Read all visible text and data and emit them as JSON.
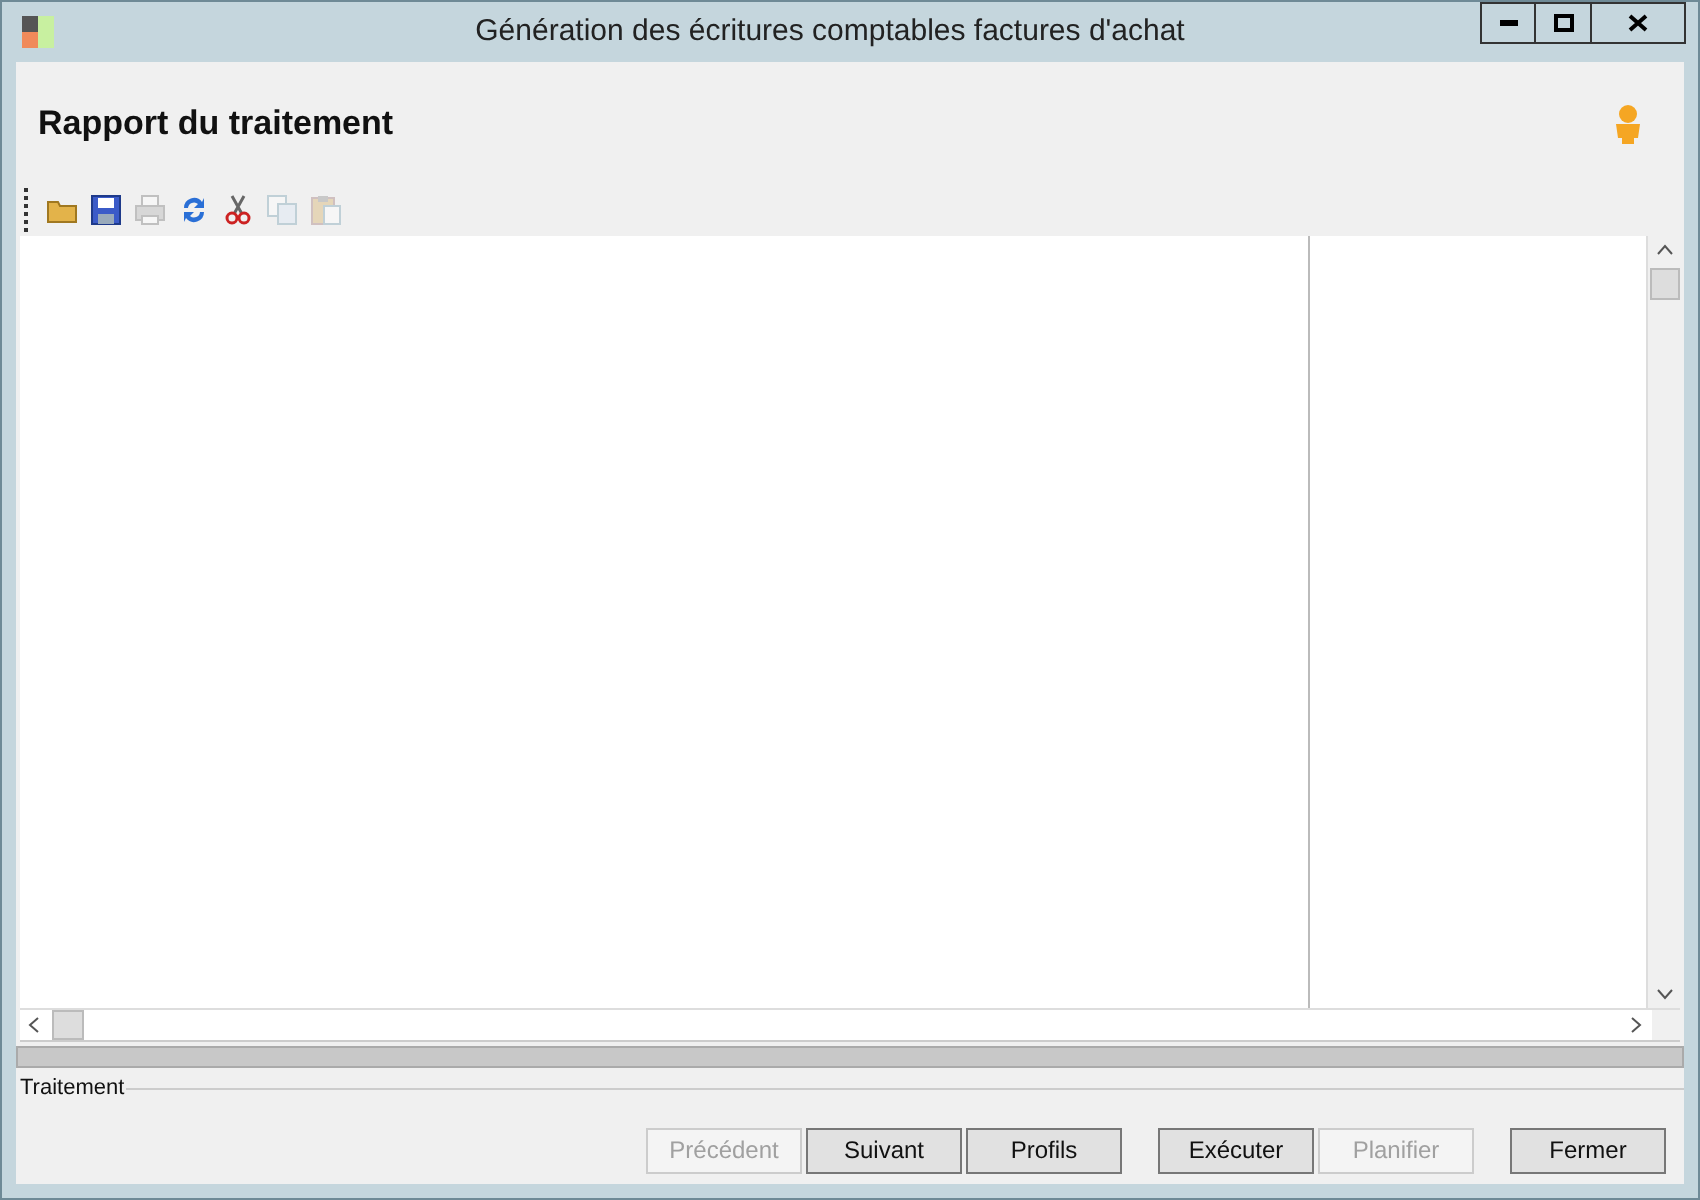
{
  "window": {
    "title": "Génération des écritures comptables factures d'achat"
  },
  "header": {
    "title": "Rapport du traitement"
  },
  "toolbar": [
    {
      "kind": "folder",
      "disabled": false
    },
    {
      "kind": "save",
      "disabled": false
    },
    {
      "kind": "print",
      "disabled": true
    },
    {
      "kind": "refresh",
      "disabled": false
    },
    {
      "kind": "cut",
      "disabled": false
    },
    {
      "kind": "copy",
      "disabled": true
    },
    {
      "kind": "paste",
      "disabled": true
    }
  ],
  "progress": {
    "level": 0
  },
  "group": {
    "label": "Traitement"
  },
  "button_groups": [
    [
      {
        "label": "Précédent",
        "disabled": true
      },
      {
        "label": "Suivant",
        "disabled": false
      },
      {
        "label": "Profils",
        "disabled": false
      }
    ],
    [
      {
        "label": "Exécuter",
        "disabled": false
      },
      {
        "label": "Planifier",
        "disabled": true
      }
    ],
    [
      {
        "label": "Fermer",
        "disabled": false
      }
    ]
  ]
}
